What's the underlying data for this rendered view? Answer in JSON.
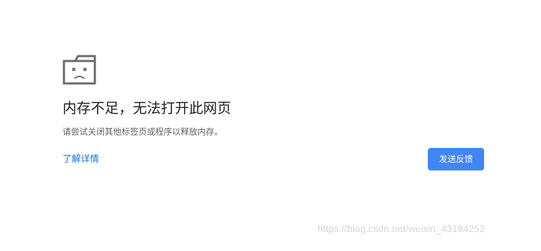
{
  "error": {
    "icon": "sad-tab-icon",
    "title": "内存不足，无法打开此网页",
    "message": "请尝试关闭其他标签页或程序以释放内存。",
    "learn_more_label": "了解详情",
    "feedback_button_label": "发送反馈"
  },
  "watermark": {
    "text": "https://blog.csdn.net/weixin_43184252"
  },
  "colors": {
    "background": "#ffffff",
    "title": "#202124",
    "message": "#5f6368",
    "link": "#1a73e8",
    "button_background": "#4285f4",
    "button_text": "#ffffff",
    "watermark": "#d6d6d6"
  }
}
